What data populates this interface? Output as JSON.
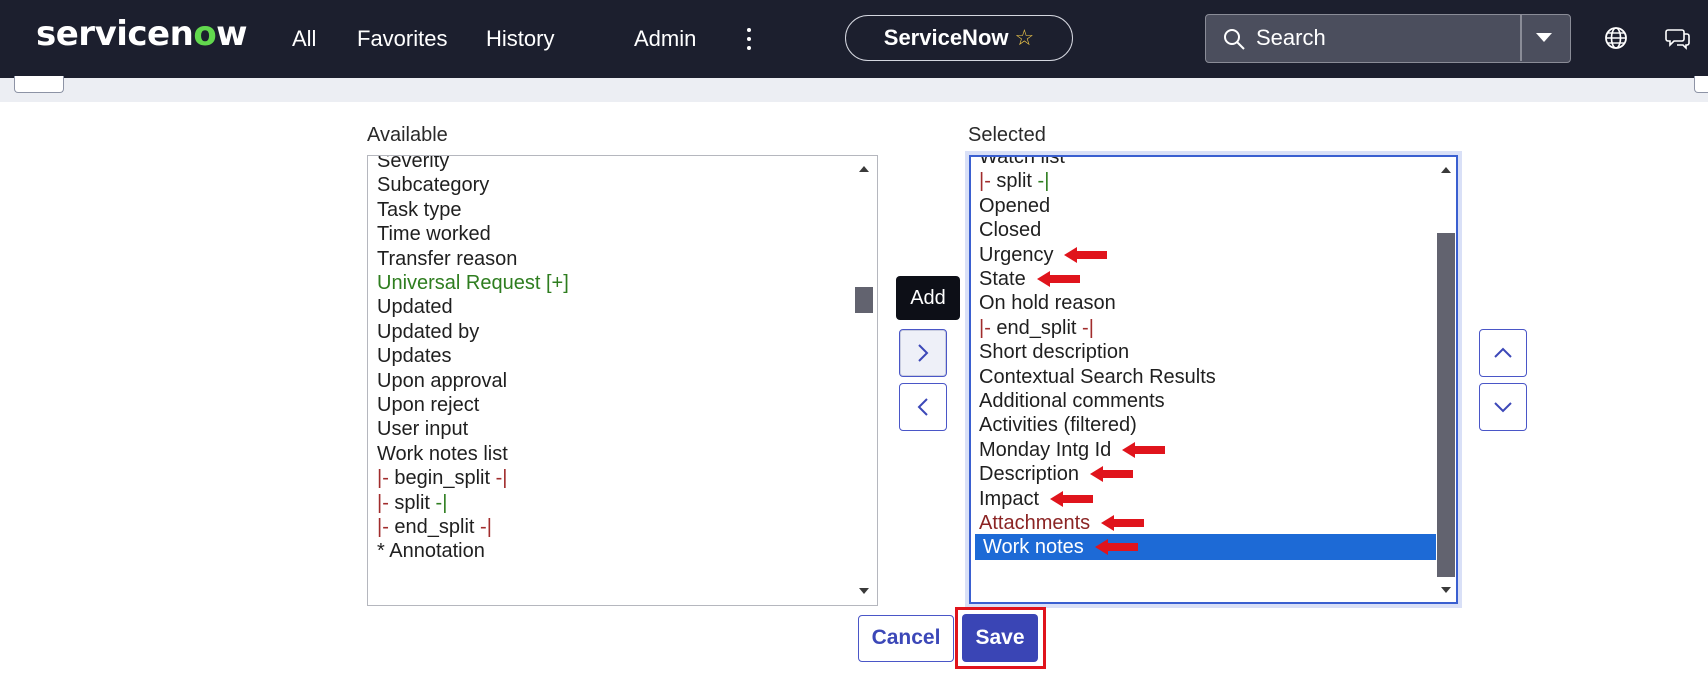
{
  "header": {
    "logo_text_pre": "servicen",
    "logo_text_o": "o",
    "logo_text_post": "w",
    "nav": [
      "All",
      "Favorites",
      "History",
      "Admin"
    ],
    "app_title": "ServiceNow",
    "search_placeholder": "Search",
    "icons": [
      "more-vertical-icon",
      "star-icon",
      "search-icon",
      "chevron-down-icon",
      "globe-icon",
      "chat-icon"
    ]
  },
  "slushbucket": {
    "available_label": "Available",
    "selected_label": "Selected",
    "available_items": [
      "Severity",
      "Subcategory",
      "Task type",
      "Time worked",
      "Transfer reason",
      "Universal Request [+]",
      "Updated",
      "Updated by",
      "Updates",
      "Upon approval",
      "Upon reject",
      "User input",
      "Work notes list",
      "|- begin_split -|",
      "|- split -|",
      "|- end_split -|",
      "* Annotation"
    ],
    "selected_items": [
      "Watch list",
      "|- split -|",
      "Opened",
      "Closed",
      "Urgency",
      "State",
      "On hold reason",
      "|- end_split -|",
      "Short description",
      "Contextual Search Results",
      "Additional comments",
      "Activities (filtered)",
      "Monday Intg Id",
      "Description",
      "Impact",
      "Attachments",
      "Work notes"
    ],
    "selected_highlight": "Work notes",
    "add_tooltip": "Add"
  },
  "actions": {
    "cancel_label": "Cancel",
    "save_label": "Save"
  },
  "colors": {
    "header_bg": "#1c1f2e",
    "brand_green": "#62d84e",
    "primary": "#3a45b5",
    "selection": "#1d6ad6",
    "annotation_red": "#e0141c"
  }
}
